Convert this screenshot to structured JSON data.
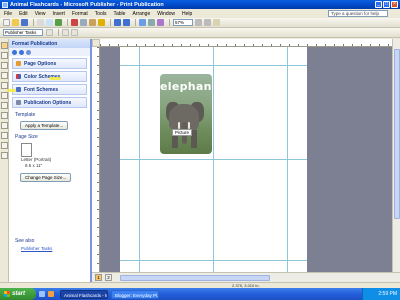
{
  "window": {
    "title": "Animal Flashcards - Microsoft Publisher - Print Publication"
  },
  "menu": [
    "File",
    "Edit",
    "View",
    "Insert",
    "Format",
    "Tools",
    "Table",
    "Arrange",
    "Window",
    "Help"
  ],
  "help_box": {
    "placeholder": "Type a question for help"
  },
  "toolbar": {
    "zoom": "57%",
    "font_name": "Publisher Tasks"
  },
  "task_pane": {
    "title": "Format Publication",
    "sections": {
      "page_options": "Page Options",
      "color_schemes": "Color Schemes",
      "font_schemes": "Font Schemes",
      "publication_options": "Publication Options"
    },
    "template_label": "Template",
    "apply_template_button": "Apply a Template...",
    "page_size_label": "Page Size",
    "page_size_line1": "Letter (Portrait)",
    "page_size_line2": "8.5 x 11\"",
    "change_page_size_button": "Change Page Size...",
    "see_also_label": "See also",
    "publisher_tasks_link": "Publisher Tasks"
  },
  "document": {
    "card_title": "elephant",
    "picture_tooltip": "Picture"
  },
  "page_tabs": [
    "1",
    "2"
  ],
  "status": {
    "coords": "2.375, 3.010 in."
  },
  "taskbar": {
    "start_label": "start",
    "tasks": [
      "Animal Flashcards - M...",
      "Blogger: Everyday Pl..."
    ],
    "clock": "2:59 PM"
  },
  "colors": {
    "title_bar": "#0048c8",
    "taskbar": "#245edb",
    "highlight": "#f5ec3a",
    "card_bg": "#87a47f"
  }
}
